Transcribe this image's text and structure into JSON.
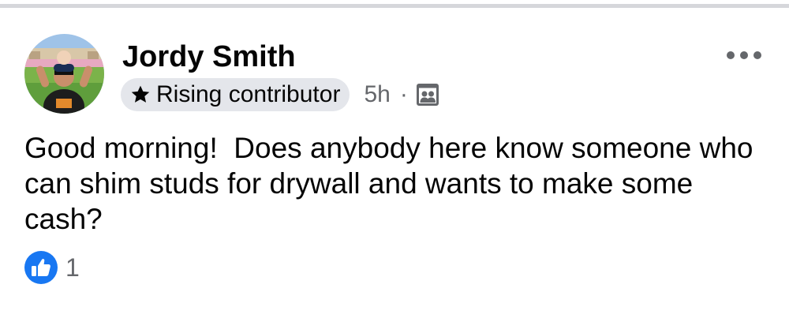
{
  "post": {
    "author": {
      "name": "Jordy Smith",
      "badge_label": "Rising contributor",
      "badge_icon": "star-icon"
    },
    "timestamp": "5h",
    "separator": "·",
    "audience_icon": "group-icon",
    "more_icon": "more-options-icon",
    "text": "Good morning!  Does anybody here know someone who can shim studs for drywall and wants to make some cash?",
    "reactions": {
      "icon": "like-icon",
      "count": "1"
    }
  },
  "colors": {
    "like_blue": "#1877f2",
    "secondary_text": "#65676b",
    "badge_background": "#e4e6eb",
    "primary_text": "#050505"
  }
}
